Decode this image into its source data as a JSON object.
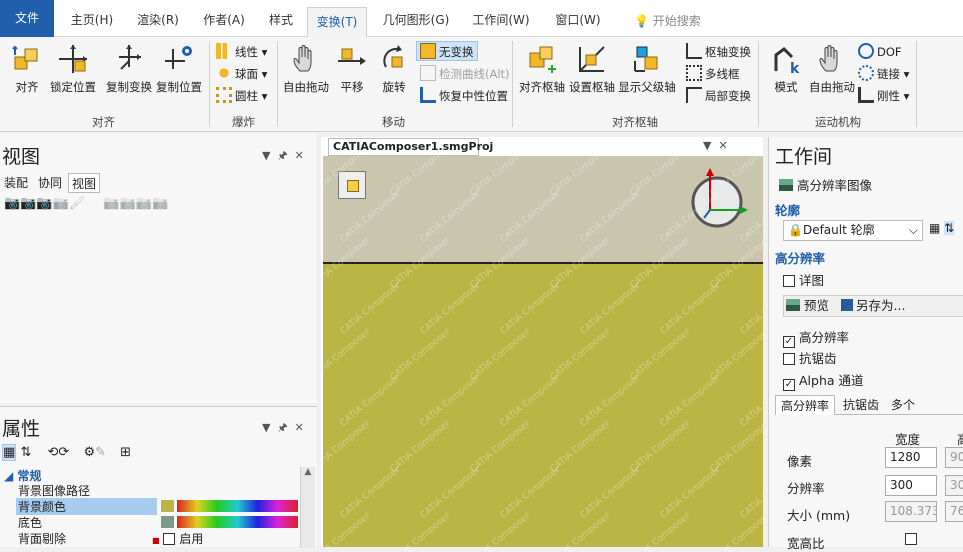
{
  "menu": {
    "file": "文件",
    "tabs": [
      "主页(H)",
      "渲染(R)",
      "作者(A)",
      "样式",
      "变换(T)",
      "几何图形(G)",
      "工作间(W)",
      "窗口(W)"
    ],
    "search": "开始搜索"
  },
  "ribbon": {
    "align": {
      "b1": "对齐",
      "b2": "锁定位置",
      "b3": "复制变换",
      "b4": "复制位置",
      "label": "对齐"
    },
    "explode": {
      "i1": "线性",
      "i2": "球面",
      "i3": "圆柱",
      "label": "爆炸"
    },
    "move": {
      "b1": "自由拖动",
      "b2": "平移",
      "b3": "旋转",
      "i1": "无变换",
      "i2": "检测曲线(Alt)",
      "i3": "恢复中性位置",
      "label": "移动"
    },
    "pivot": {
      "b1": "对齐枢轴",
      "b2": "设置枢轴",
      "b3": "显示父级轴",
      "i1": "枢轴变换",
      "i2": "多线框",
      "i3": "局部变换",
      "label": "对齐枢轴"
    },
    "kin": {
      "b1": "模式",
      "b2": "自由拖动",
      "i1": "DOF",
      "i2": "链接",
      "i3": "刚性",
      "label": "运动机构"
    }
  },
  "view_panel": {
    "title": "视图",
    "tabs": [
      "装配",
      "协同",
      "视图"
    ]
  },
  "props_panel": {
    "title": "属性",
    "category": "常规",
    "rows": [
      "背景图像路径",
      "背景颜色",
      "底色",
      "背面剔除"
    ],
    "enable": "启用"
  },
  "document": {
    "tab": "CATIAComposer1.smgProj",
    "watermark": "CATIA Composer"
  },
  "workspace": {
    "title": "工作间",
    "item": "高分辨率图像",
    "profile_label": "轮廓",
    "profile_value": "Default 轮廓",
    "section": "高分辨率",
    "detail": "详图",
    "preview": "预览",
    "saveas": "另存为...",
    "hr": "高分辨率",
    "aa": "抗锯齿",
    "alpha": "Alpha 通道",
    "tabs": [
      "高分辨率",
      "抗锯齿",
      "多个"
    ],
    "col_width": "宽度",
    "col_h": "高",
    "pixels_label": "像素",
    "pixels_w": "1280",
    "pixels_h": "90",
    "res_label": "分辨率",
    "res_w": "300",
    "res_h": "30",
    "size_label": "大小 (mm)",
    "size_w": "108.373",
    "size_h": "76",
    "ratio_label": "宽高比"
  },
  "colors": {
    "accent": "#1f5fab",
    "ground": "#bab545",
    "sky": "#c9c6ad"
  }
}
